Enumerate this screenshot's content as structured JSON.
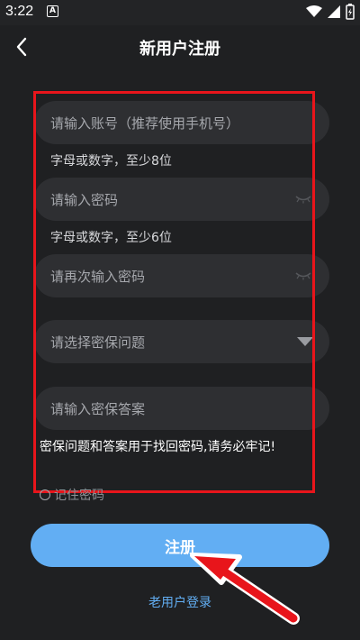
{
  "status_bar": {
    "time": "3:22",
    "notification_glyph": "A"
  },
  "header": {
    "title": "新用户注册"
  },
  "form": {
    "account_placeholder": "请输入账号（推荐使用手机号）",
    "account_hint": "字母或数字，至少8位",
    "password_placeholder": "请输入密码",
    "password_hint": "字母或数字，至少6位",
    "confirm_placeholder": "请再次输入密码",
    "security_question_placeholder": "请选择密保问题",
    "security_answer_placeholder": "请输入密保答案",
    "security_warning": "密保问题和答案用于找回密码,请务必牢记!",
    "remember_label": "记住密码"
  },
  "actions": {
    "register_label": "注册",
    "login_link": "老用户登录"
  },
  "colors": {
    "background": "#1f2022",
    "field": "#2e2f32",
    "accent": "#62aef3",
    "annotation": "#e8151b"
  },
  "icons": [
    "back-arrow-icon",
    "eye-closed-icon",
    "dropdown-triangle-icon",
    "wifi-icon",
    "signal-icon",
    "battery-icon"
  ]
}
